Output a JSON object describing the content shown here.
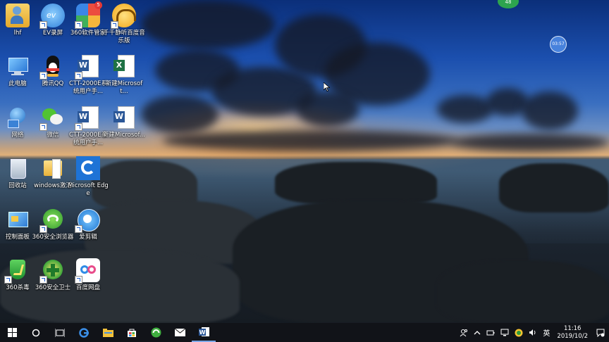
{
  "desktop": {
    "icons": [
      {
        "label": "lhf",
        "icon": "user-folder-icon"
      },
      {
        "label": "EV录屏",
        "icon": "ev-recorder-icon"
      },
      {
        "label": "360软件管家",
        "icon": "360-software-manager-icon",
        "badge": "5"
      },
      {
        "label": "千千静听百度音乐版",
        "icon": "ttplayer-music-icon"
      },
      {
        "label": "此电脑",
        "icon": "this-pc-icon"
      },
      {
        "label": "腾讯QQ",
        "icon": "qq-penguin-icon"
      },
      {
        "label": "CTT-2000E系统用户手...",
        "icon": "word-document-icon"
      },
      {
        "label": "新建Microsoft...",
        "icon": "excel-document-icon"
      },
      {
        "label": "网络",
        "icon": "network-icon"
      },
      {
        "label": "微信",
        "icon": "wechat-icon"
      },
      {
        "label": "CTT-2000E系统用户手...",
        "icon": "word-document-icon"
      },
      {
        "label": "新建Microsof...",
        "icon": "word-document-icon"
      },
      {
        "label": "回收站",
        "icon": "recycle-bin-icon"
      },
      {
        "label": "windows激活",
        "icon": "folder-icon"
      },
      {
        "label": "Microsoft Edge",
        "icon": "edge-icon"
      },
      {
        "label": "控制面板",
        "icon": "control-panel-icon"
      },
      {
        "label": "360安全浏览器",
        "icon": "360-browser-icon"
      },
      {
        "label": "爱剪辑",
        "icon": "aijianji-icon"
      },
      {
        "label": "360杀毒",
        "icon": "360-antivirus-icon"
      },
      {
        "label": "360安全卫士",
        "icon": "360-safe-guard-icon"
      },
      {
        "label": "百度网盘",
        "icon": "baidu-netdisk-icon"
      }
    ],
    "badge_green": "48",
    "float_ball": "03:57"
  },
  "taskbar": {
    "apps": [
      "start-icon",
      "search-circle-icon",
      "task-view-icon",
      "edge-icon",
      "file-explorer-icon",
      "store-icon",
      "360-browser-icon",
      "mail-icon",
      "word-icon"
    ],
    "tray": {
      "ime": "英",
      "time": "11:16",
      "date": "2019/10/2"
    }
  },
  "colors": {
    "taskbar_bg": "#111318",
    "accent": "#1c5fcf"
  }
}
